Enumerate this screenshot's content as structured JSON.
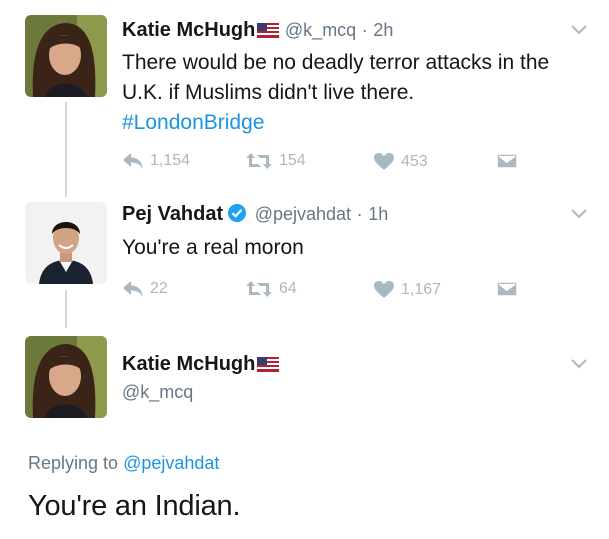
{
  "tweets": [
    {
      "name": "Katie McHugh",
      "handle": "@k_mcq",
      "separator": "·",
      "time": "2h",
      "text": "There would be no deadly terror attacks in the U.K. if Muslims didn't live there.",
      "hashtag": "#LondonBridge",
      "replies": "1,154",
      "retweets": "154",
      "likes": "453"
    },
    {
      "name": "Pej Vahdat",
      "handle": "@pejvahdat",
      "separator": "·",
      "time": "1h",
      "text": "You're a real moron",
      "replies": "22",
      "retweets": "64",
      "likes": "1,167"
    },
    {
      "name": "Katie McHugh",
      "handle": "@k_mcq"
    }
  ],
  "reply": {
    "prefix": "Replying to",
    "mention": "@pejvahdat",
    "text": "You're an Indian."
  },
  "colors": {
    "link": "#1b95e0",
    "muted": "#657786",
    "action": "#aab8c2",
    "verified": "#1da1f2"
  },
  "icons": [
    "us-flag-icon",
    "chevron-down-icon",
    "reply-icon",
    "retweet-icon",
    "like-icon",
    "message-icon",
    "verified-badge-icon"
  ]
}
